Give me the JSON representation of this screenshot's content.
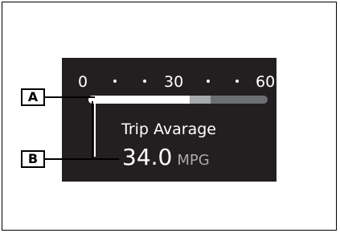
{
  "scale": {
    "labels": [
      "0",
      "30",
      "60"
    ],
    "fill_value": 34.0,
    "secondary_value": 41,
    "max": 60
  },
  "trip": {
    "label": "Trip Avarage",
    "value": "34.0",
    "unit": "MPG"
  },
  "callouts": {
    "a": "A",
    "b": "B"
  },
  "colors": {
    "panel": "#231f20",
    "fill": "#ffffff",
    "secondary": "#a7a9ac",
    "track": "#6d6e71"
  }
}
